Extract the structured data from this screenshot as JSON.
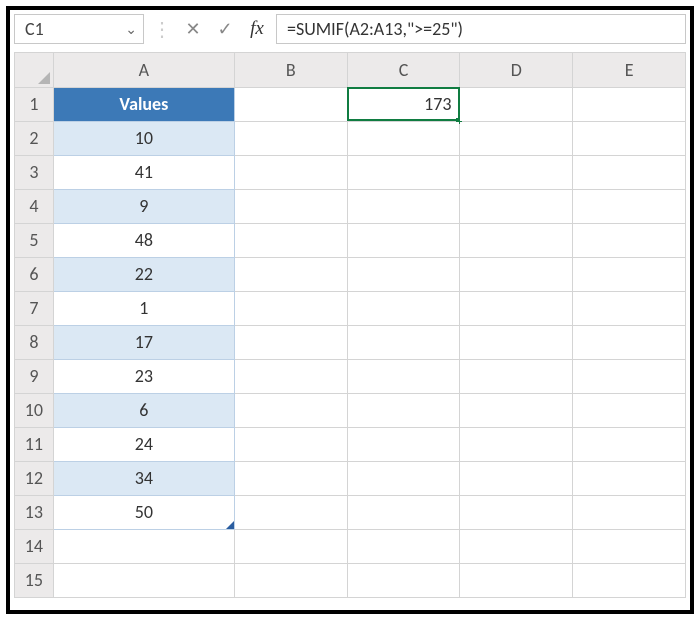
{
  "namebox": {
    "value": "C1"
  },
  "formula_bar": {
    "formula": "=SUMIF(A2:A13,\">=25\")"
  },
  "columns": [
    "A",
    "B",
    "C",
    "D",
    "E"
  ],
  "rows": [
    "1",
    "2",
    "3",
    "4",
    "5",
    "6",
    "7",
    "8",
    "9",
    "10",
    "11",
    "12",
    "13",
    "14",
    "15"
  ],
  "table": {
    "header": "Values",
    "data": [
      "10",
      "41",
      "9",
      "48",
      "22",
      "1",
      "17",
      "23",
      "6",
      "24",
      "34",
      "50"
    ]
  },
  "result_cell": {
    "ref": "C1",
    "value": "173"
  },
  "icons": {
    "chevron": "⌄",
    "cancel": "✕",
    "enter": "✓",
    "fx": "fx"
  }
}
